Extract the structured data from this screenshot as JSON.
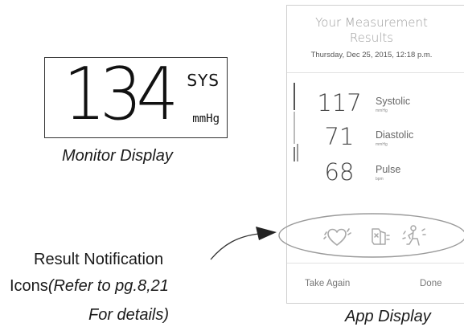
{
  "monitor": {
    "value": "134",
    "label": "SYS",
    "unit": "mmHg",
    "caption": "Monitor Display"
  },
  "notification": {
    "line1": "Result Notification",
    "line2_prefix": "Icons",
    "line2_italic": "(Refer to pg.8,21",
    "line3": "For details)"
  },
  "app": {
    "title_line1": "Your Measurement",
    "title_line2": "Results",
    "date": "Thursday, Dec 25, 2015, 12:18 p.m.",
    "readings": [
      {
        "value": "117",
        "label": "Systolic",
        "unit": "mmHg"
      },
      {
        "value": "71",
        "label": "Diastolic",
        "unit": "mmHg"
      },
      {
        "value": "68",
        "label": "Pulse",
        "unit": "bpm"
      }
    ],
    "icons": [
      "irregular-heartbeat-icon",
      "cuff-wrap-guide-icon",
      "body-movement-icon"
    ],
    "buttons": {
      "take_again": "Take Again",
      "done": "Done"
    },
    "caption": "App Display"
  },
  "colors": {
    "icon_gray": "#a8a8a8",
    "text_gray": "#9c9c9c",
    "ink": "#1a1a1a"
  }
}
